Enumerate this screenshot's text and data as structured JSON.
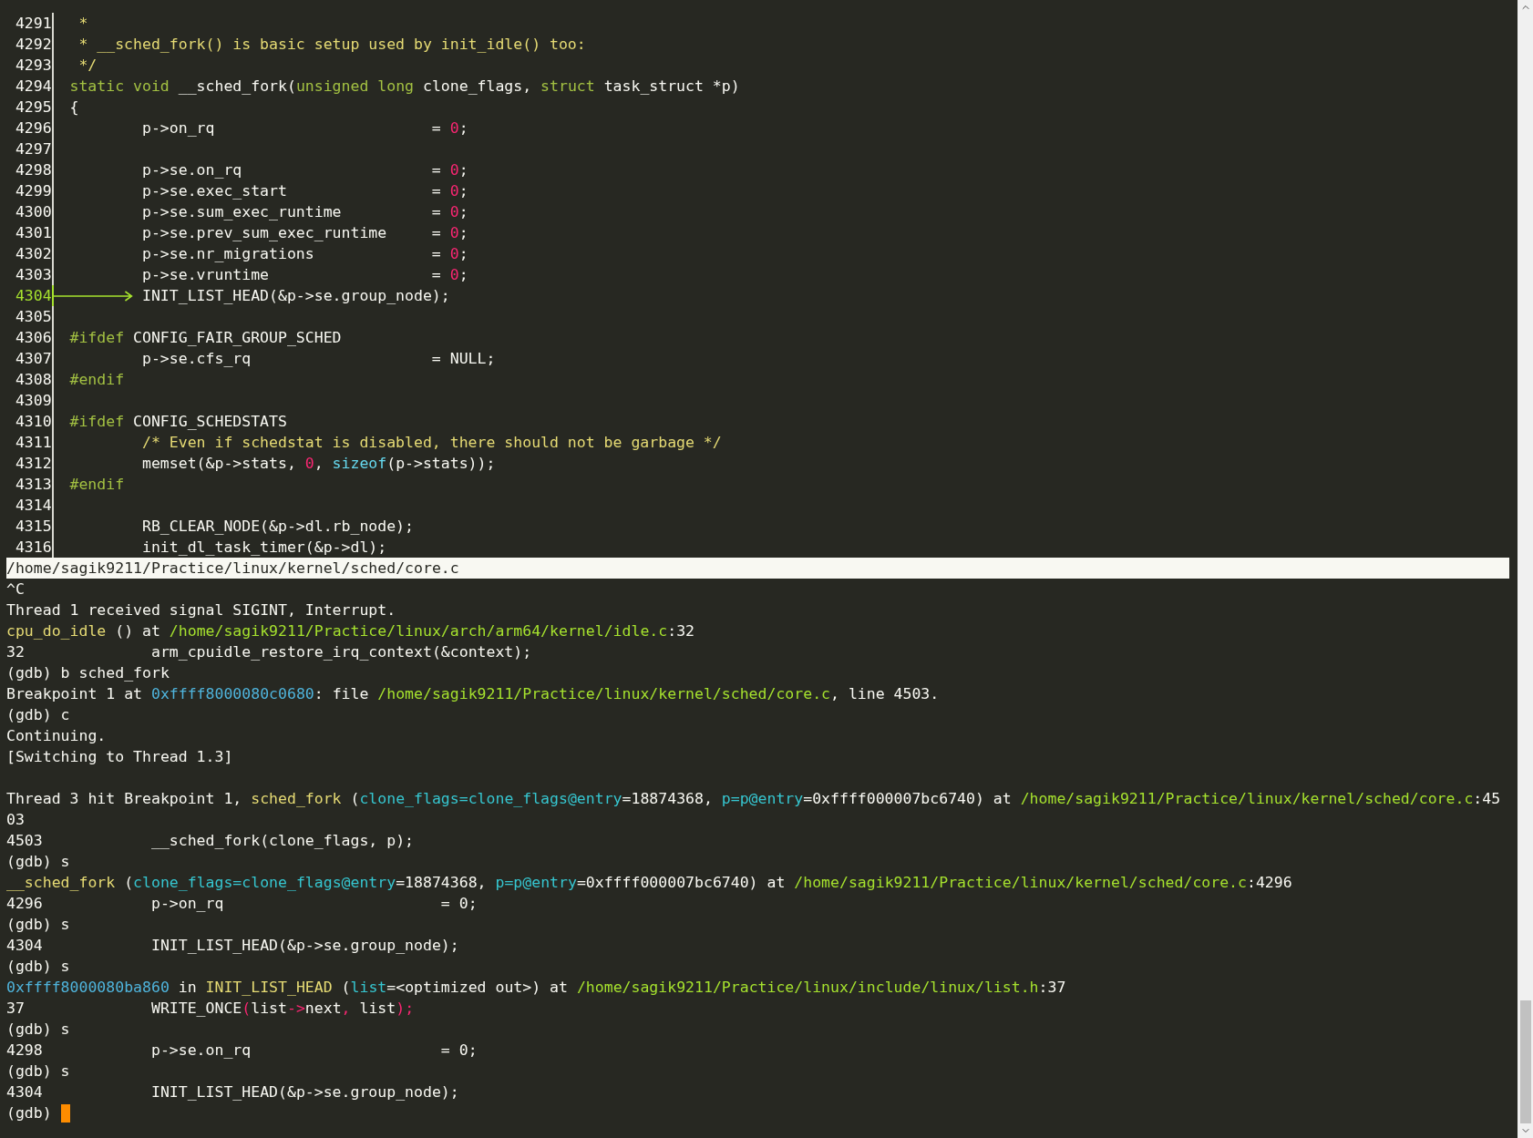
{
  "source_window": {
    "lines": [
      {
        "number": "4291",
        "current": false,
        "segments": [
          {
            "kind": "comment",
            "text": " *"
          }
        ]
      },
      {
        "number": "4292",
        "current": false,
        "segments": [
          {
            "kind": "comment",
            "text": " * __sched_fork() is basic setup used by init_idle() too:"
          }
        ]
      },
      {
        "number": "4293",
        "current": false,
        "segments": [
          {
            "kind": "comment",
            "text": " */"
          }
        ]
      },
      {
        "number": "4294",
        "current": false,
        "segments": [
          {
            "kind": "keyword",
            "text": "static "
          },
          {
            "kind": "keyword",
            "text": "void"
          },
          {
            "kind": "plain",
            "text": " __sched_fork("
          },
          {
            "kind": "keyword",
            "text": "unsigned "
          },
          {
            "kind": "keyword",
            "text": "long"
          },
          {
            "kind": "plain",
            "text": " clone_flags, "
          },
          {
            "kind": "keyword",
            "text": "struct"
          },
          {
            "kind": "plain",
            "text": " task_struct *p)"
          }
        ]
      },
      {
        "number": "4295",
        "current": false,
        "segments": [
          {
            "kind": "plain",
            "text": "{"
          }
        ]
      },
      {
        "number": "4296",
        "current": false,
        "segments": [
          {
            "kind": "plain",
            "text": "        p->on_rq                        = "
          },
          {
            "kind": "number",
            "text": "0"
          },
          {
            "kind": "plain",
            "text": ";"
          }
        ]
      },
      {
        "number": "4297",
        "current": false
      },
      {
        "number": "4298",
        "current": false,
        "segments": [
          {
            "kind": "plain",
            "text": "        p->se.on_rq                     = "
          },
          {
            "kind": "number",
            "text": "0"
          },
          {
            "kind": "plain",
            "text": ";"
          }
        ]
      },
      {
        "number": "4299",
        "current": false,
        "segments": [
          {
            "kind": "plain",
            "text": "        p->se.exec_start                = "
          },
          {
            "kind": "number",
            "text": "0"
          },
          {
            "kind": "plain",
            "text": ";"
          }
        ]
      },
      {
        "number": "4300",
        "current": false,
        "segments": [
          {
            "kind": "plain",
            "text": "        p->se.sum_exec_runtime          = "
          },
          {
            "kind": "number",
            "text": "0"
          },
          {
            "kind": "plain",
            "text": ";"
          }
        ]
      },
      {
        "number": "4301",
        "current": false,
        "segments": [
          {
            "kind": "plain",
            "text": "        p->se.prev_sum_exec_runtime     = "
          },
          {
            "kind": "number",
            "text": "0"
          },
          {
            "kind": "plain",
            "text": ";"
          }
        ]
      },
      {
        "number": "4302",
        "current": false,
        "segments": [
          {
            "kind": "plain",
            "text": "        p->se.nr_migrations             = "
          },
          {
            "kind": "number",
            "text": "0"
          },
          {
            "kind": "plain",
            "text": ";"
          }
        ]
      },
      {
        "number": "4303",
        "current": false,
        "segments": [
          {
            "kind": "plain",
            "text": "        p->se.vruntime                  = "
          },
          {
            "kind": "number",
            "text": "0"
          },
          {
            "kind": "plain",
            "text": ";"
          }
        ]
      },
      {
        "number": "4304",
        "current": true,
        "segments": [
          {
            "kind": "plain",
            "text": "        INIT_LIST_HEAD(&p->se.group_node);"
          }
        ]
      },
      {
        "number": "4305",
        "current": false
      },
      {
        "number": "4306",
        "current": false,
        "segments": [
          {
            "kind": "keyword",
            "text": "#ifdef"
          },
          {
            "kind": "plain",
            "text": " CONFIG_FAIR_GROUP_SCHED"
          }
        ]
      },
      {
        "number": "4307",
        "current": false,
        "segments": [
          {
            "kind": "plain",
            "text": "        p->se.cfs_rq                    = NULL;"
          }
        ]
      },
      {
        "number": "4308",
        "current": false,
        "segments": [
          {
            "kind": "keyword",
            "text": "#endif"
          }
        ]
      },
      {
        "number": "4309",
        "current": false
      },
      {
        "number": "4310",
        "current": false,
        "segments": [
          {
            "kind": "keyword",
            "text": "#ifdef"
          },
          {
            "kind": "plain",
            "text": " CONFIG_SCHEDSTATS"
          }
        ]
      },
      {
        "number": "4311",
        "current": false,
        "segments": [
          {
            "kind": "comment",
            "text": "        /* Even if schedstat is disabled, there should not be garbage */"
          }
        ]
      },
      {
        "number": "4312",
        "current": false,
        "segments": [
          {
            "kind": "plain",
            "text": "        memset(&p->stats, "
          },
          {
            "kind": "number",
            "text": "0"
          },
          {
            "kind": "plain",
            "text": ", "
          },
          {
            "kind": "builtin",
            "text": "sizeof"
          },
          {
            "kind": "plain",
            "text": "(p->stats));"
          }
        ]
      },
      {
        "number": "4313",
        "current": false,
        "segments": [
          {
            "kind": "keyword",
            "text": "#endif"
          }
        ]
      },
      {
        "number": "4314",
        "current": false
      },
      {
        "number": "4315",
        "current": false,
        "segments": [
          {
            "kind": "plain",
            "text": "        RB_CLEAR_NODE(&p->dl.rb_node);"
          }
        ]
      },
      {
        "number": "4316",
        "current": false,
        "segments": [
          {
            "kind": "plain",
            "text": "        init_dl_task_timer(&p->dl);"
          }
        ]
      }
    ]
  },
  "status_bar": {
    "path": "/home/sagik9211/Practice/linux/kernel/sched/core.c"
  },
  "command_window": {
    "lines": [
      {
        "segments": [
          {
            "kind": "plain",
            "text": "^C"
          }
        ]
      },
      {
        "segments": [
          {
            "kind": "plain",
            "text": "Thread 1 received signal SIGINT, Interrupt."
          }
        ]
      },
      {
        "segments": [
          {
            "kind": "func",
            "text": "cpu_do_idle"
          },
          {
            "kind": "plain",
            "text": " () at "
          },
          {
            "kind": "path",
            "text": "/home/sagik9211/Practice/linux/arch/arm64/kernel/idle.c"
          },
          {
            "kind": "plain",
            "text": ":32"
          }
        ]
      },
      {
        "segments": [
          {
            "kind": "plain",
            "text": "32              arm_cpuidle_restore_irq_context(&context);"
          }
        ]
      },
      {
        "segments": [
          {
            "kind": "plain",
            "text": "(gdb) b sched_fork"
          }
        ]
      },
      {
        "segments": [
          {
            "kind": "plain",
            "text": "Breakpoint 1 at "
          },
          {
            "kind": "addr",
            "text": "0xffff8000080c0680"
          },
          {
            "kind": "plain",
            "text": ": file "
          },
          {
            "kind": "path",
            "text": "/home/sagik9211/Practice/linux/kernel/sched/core.c"
          },
          {
            "kind": "plain",
            "text": ", line 4503."
          }
        ]
      },
      {
        "segments": [
          {
            "kind": "plain",
            "text": "(gdb) c"
          }
        ]
      },
      {
        "segments": [
          {
            "kind": "plain",
            "text": "Continuing."
          }
        ]
      },
      {
        "segments": [
          {
            "kind": "plain",
            "text": "[Switching to Thread 1.3]"
          }
        ]
      },
      {
        "cursor": false
      },
      {
        "segments": [
          {
            "kind": "plain",
            "text": "Thread 3 hit Breakpoint 1, "
          },
          {
            "kind": "func",
            "text": "sched_fork"
          },
          {
            "kind": "plain",
            "text": " ("
          },
          {
            "kind": "param",
            "text": "clone_flags=clone_flags@entry"
          },
          {
            "kind": "plain",
            "text": "=18874368, "
          },
          {
            "kind": "param",
            "text": "p=p@entry"
          },
          {
            "kind": "plain",
            "text": "=0xffff000007bc6740) at "
          },
          {
            "kind": "path",
            "text": "/home/sagik9211/Practice/linux/kernel/sched/core.c"
          },
          {
            "kind": "plain",
            "text": ":45"
          }
        ]
      },
      {
        "segments": [
          {
            "kind": "plain",
            "text": "03"
          }
        ]
      },
      {
        "segments": [
          {
            "kind": "plain",
            "text": "4503            __sched_fork(clone_flags, p);"
          }
        ]
      },
      {
        "segments": [
          {
            "kind": "plain",
            "text": "(gdb) s"
          }
        ]
      },
      {
        "segments": [
          {
            "kind": "func",
            "text": "__sched_fork"
          },
          {
            "kind": "plain",
            "text": " ("
          },
          {
            "kind": "param",
            "text": "clone_flags=clone_flags@entry"
          },
          {
            "kind": "plain",
            "text": "=18874368, "
          },
          {
            "kind": "param",
            "text": "p=p@entry"
          },
          {
            "kind": "plain",
            "text": "=0xffff000007bc6740) at "
          },
          {
            "kind": "path",
            "text": "/home/sagik9211/Practice/linux/kernel/sched/core.c"
          },
          {
            "kind": "plain",
            "text": ":4296"
          }
        ]
      },
      {
        "segments": [
          {
            "kind": "plain",
            "text": "4296            p->on_rq                        = 0;"
          }
        ]
      },
      {
        "segments": [
          {
            "kind": "plain",
            "text": "(gdb) s"
          }
        ]
      },
      {
        "segments": [
          {
            "kind": "plain",
            "text": "4304            INIT_LIST_HEAD(&p->se.group_node);"
          }
        ]
      },
      {
        "segments": [
          {
            "kind": "plain",
            "text": "(gdb) s"
          }
        ]
      },
      {
        "segments": [
          {
            "kind": "addr",
            "text": "0xffff8000080ba860"
          },
          {
            "kind": "plain",
            "text": " in "
          },
          {
            "kind": "func",
            "text": "INIT_LIST_HEAD"
          },
          {
            "kind": "plain",
            "text": " ("
          },
          {
            "kind": "param",
            "text": "list"
          },
          {
            "kind": "plain",
            "text": "=<optimized out>) at "
          },
          {
            "kind": "path",
            "text": "/home/sagik9211/Practice/linux/include/linux/list.h"
          },
          {
            "kind": "plain",
            "text": ":37"
          }
        ]
      },
      {
        "segments": [
          {
            "kind": "plain",
            "text": "37              WRITE_ONCE"
          },
          {
            "kind": "punct",
            "text": "("
          },
          {
            "kind": "plain",
            "text": "list"
          },
          {
            "kind": "punct",
            "text": "->"
          },
          {
            "kind": "plain",
            "text": "next"
          },
          {
            "kind": "punct",
            "text": ","
          },
          {
            "kind": "plain",
            "text": " list"
          },
          {
            "kind": "punct",
            "text": ");"
          }
        ]
      },
      {
        "segments": [
          {
            "kind": "plain",
            "text": "(gdb) s"
          }
        ]
      },
      {
        "segments": [
          {
            "kind": "plain",
            "text": "4298            p->se.on_rq                     = 0;"
          }
        ]
      },
      {
        "segments": [
          {
            "kind": "plain",
            "text": "(gdb) s"
          }
        ]
      },
      {
        "segments": [
          {
            "kind": "plain",
            "text": "4304            INIT_LIST_HEAD(&p->se.group_node);"
          }
        ]
      },
      {
        "segments": [
          {
            "kind": "plain",
            "text": "(gdb) "
          }
        ],
        "cursor": true
      }
    ]
  }
}
